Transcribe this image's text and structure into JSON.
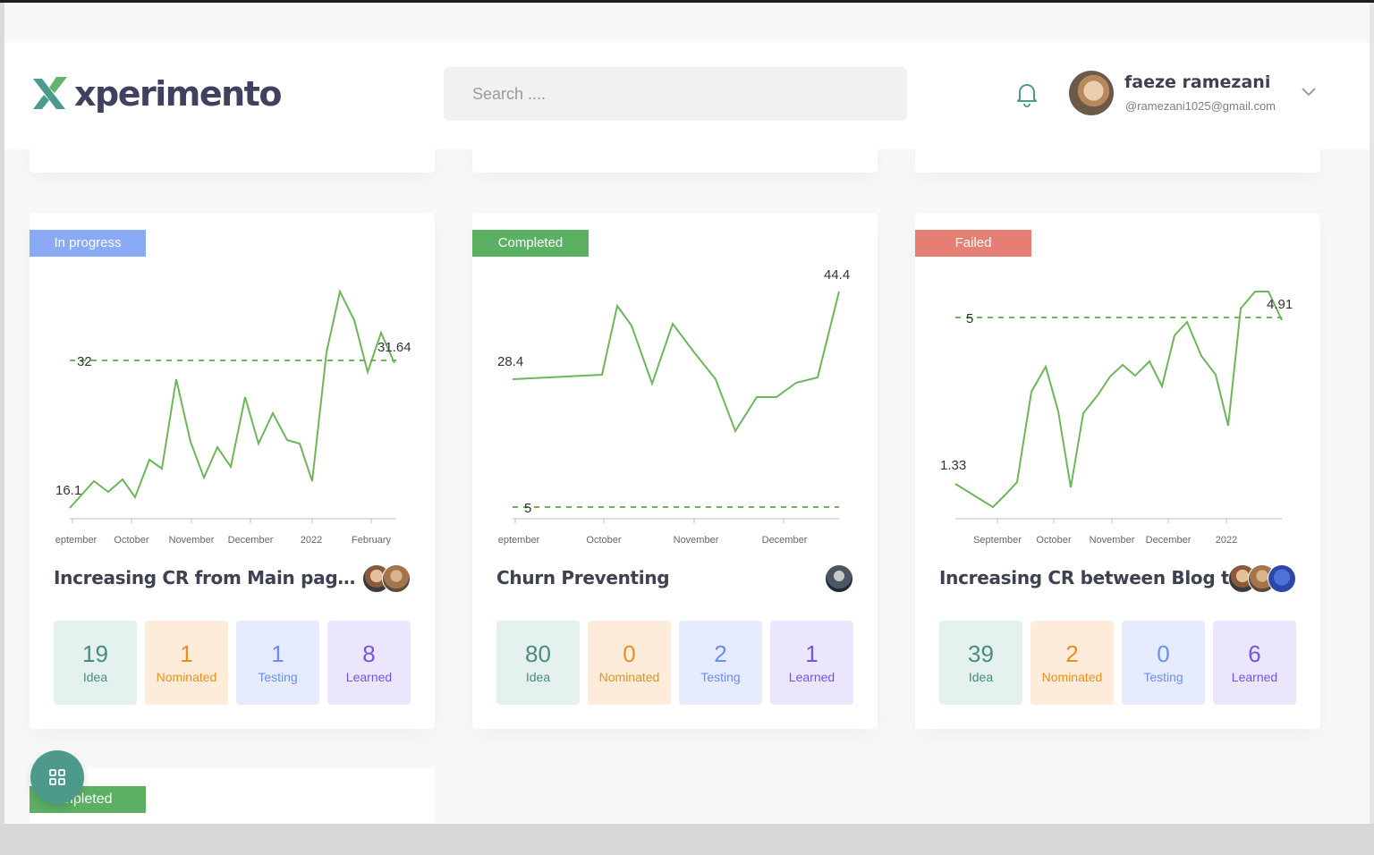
{
  "header": {
    "logo_text": "xperimento",
    "search_placeholder": "Search ....",
    "user_name": "faeze ramezani",
    "user_email": "@ramezani1025@gmail.com",
    "icons": [
      "logo-icon",
      "bell-icon",
      "chevron-down-icon"
    ]
  },
  "colors": {
    "brand_green": "#4d9a8c",
    "in_progress": "#8aaaf5",
    "completed": "#5cb064",
    "failed": "#e57f75",
    "line": "#6db65a"
  },
  "cards": [
    {
      "status": "In progress",
      "status_color": "#8aaaf5",
      "title": "Increasing CR from Main page to ...",
      "stats": {
        "idea": "19",
        "nominated": "1",
        "testing": "1",
        "learned": "8"
      },
      "chart": {
        "baseline_label": "32",
        "min_label": "16.1",
        "end_label": "31.64",
        "x_ticks": [
          "eptember",
          "October",
          "November",
          "December",
          "2022",
          "February"
        ]
      }
    },
    {
      "status": "Completed",
      "status_color": "#5cb064",
      "title": "Churn Preventing",
      "stats": {
        "idea": "80",
        "nominated": "0",
        "testing": "2",
        "learned": "1"
      },
      "chart": {
        "baseline_label": "5",
        "start_label": "28.4",
        "end_label": "44.4",
        "x_ticks": [
          "eptember",
          "October",
          "November",
          "December"
        ]
      }
    },
    {
      "status": "Failed",
      "status_color": "#e57f75",
      "title": "Increasing CR between Blog to l...",
      "stats": {
        "idea": "39",
        "nominated": "2",
        "testing": "0",
        "learned": "6"
      },
      "chart": {
        "baseline_label": "5",
        "min_label": "1.33",
        "end_label": "4.91",
        "x_ticks": [
          "September",
          "October",
          "November",
          "December",
          "2022"
        ]
      }
    }
  ],
  "labels": {
    "idea": "Idea",
    "nominated": "Nominated",
    "testing": "Testing",
    "learned": "Learned"
  },
  "bottom_card": {
    "status": "npleted"
  }
}
